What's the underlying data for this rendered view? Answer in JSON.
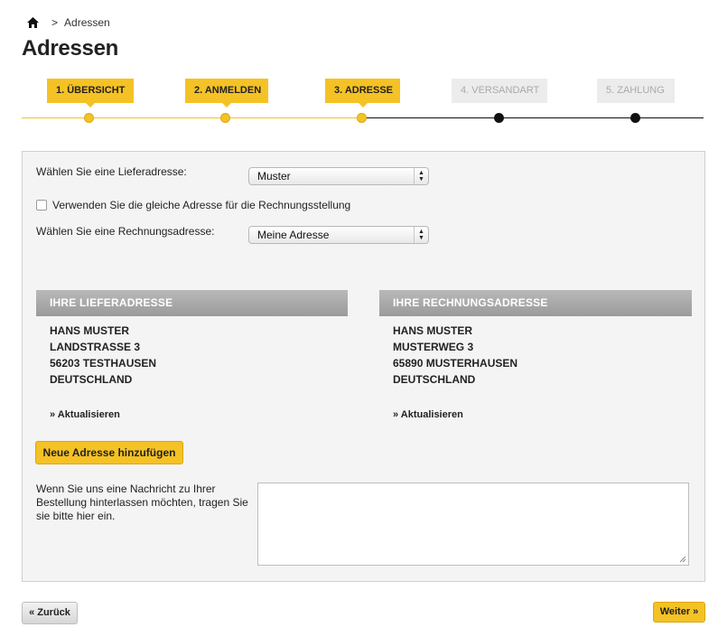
{
  "breadcrumb": {
    "separator": ">",
    "current": "Adressen"
  },
  "page": {
    "title": "Adressen"
  },
  "steps": [
    {
      "label": "1. ÜBERSICHT",
      "state": "done"
    },
    {
      "label": "2. ANMELDEN",
      "state": "done"
    },
    {
      "label": "3. ADRESSE",
      "state": "done"
    },
    {
      "label": "4. VERSANDART",
      "state": "todo"
    },
    {
      "label": "5. ZAHLUNG",
      "state": "todo"
    }
  ],
  "form": {
    "delivery_label": "Wählen Sie eine Lieferadresse:",
    "delivery_value": "Muster",
    "same_address_label": "Verwenden Sie die gleiche Adresse für die Rechnungsstellung",
    "same_address_checked": false,
    "billing_label": "Wählen Sie eine Rechnungsadresse:",
    "billing_value": "Meine Adresse"
  },
  "delivery_address": {
    "heading": "IHRE LIEFERADRESSE",
    "lines": [
      "HANS MUSTER",
      "LANDSTRASSE 3",
      "56203 TESTHAUSEN",
      "DEUTSCHLAND"
    ],
    "update_link": "» Aktualisieren"
  },
  "billing_address": {
    "heading": "IHRE RECHNUNGSADRESSE",
    "lines": [
      "HANS MUSTER",
      "MUSTERWEG 3",
      "65890 MUSTERHAUSEN",
      "DEUTSCHLAND"
    ],
    "update_link": "» Aktualisieren"
  },
  "add_address_button": "Neue Adresse hinzufügen",
  "message": {
    "prompt": "Wenn Sie uns eine Nachricht zu Ihrer Bestellung hinterlassen möchten, tragen Sie sie bitte hier ein.",
    "value": ""
  },
  "nav": {
    "back": "« Zurück",
    "next": "Weiter »"
  },
  "colors": {
    "accent": "#f5c225",
    "inactive_step": "#ececec",
    "header_gray": "#a8a8a8"
  },
  "icons": {
    "home": "home-icon",
    "select": "select-arrows-icon"
  }
}
